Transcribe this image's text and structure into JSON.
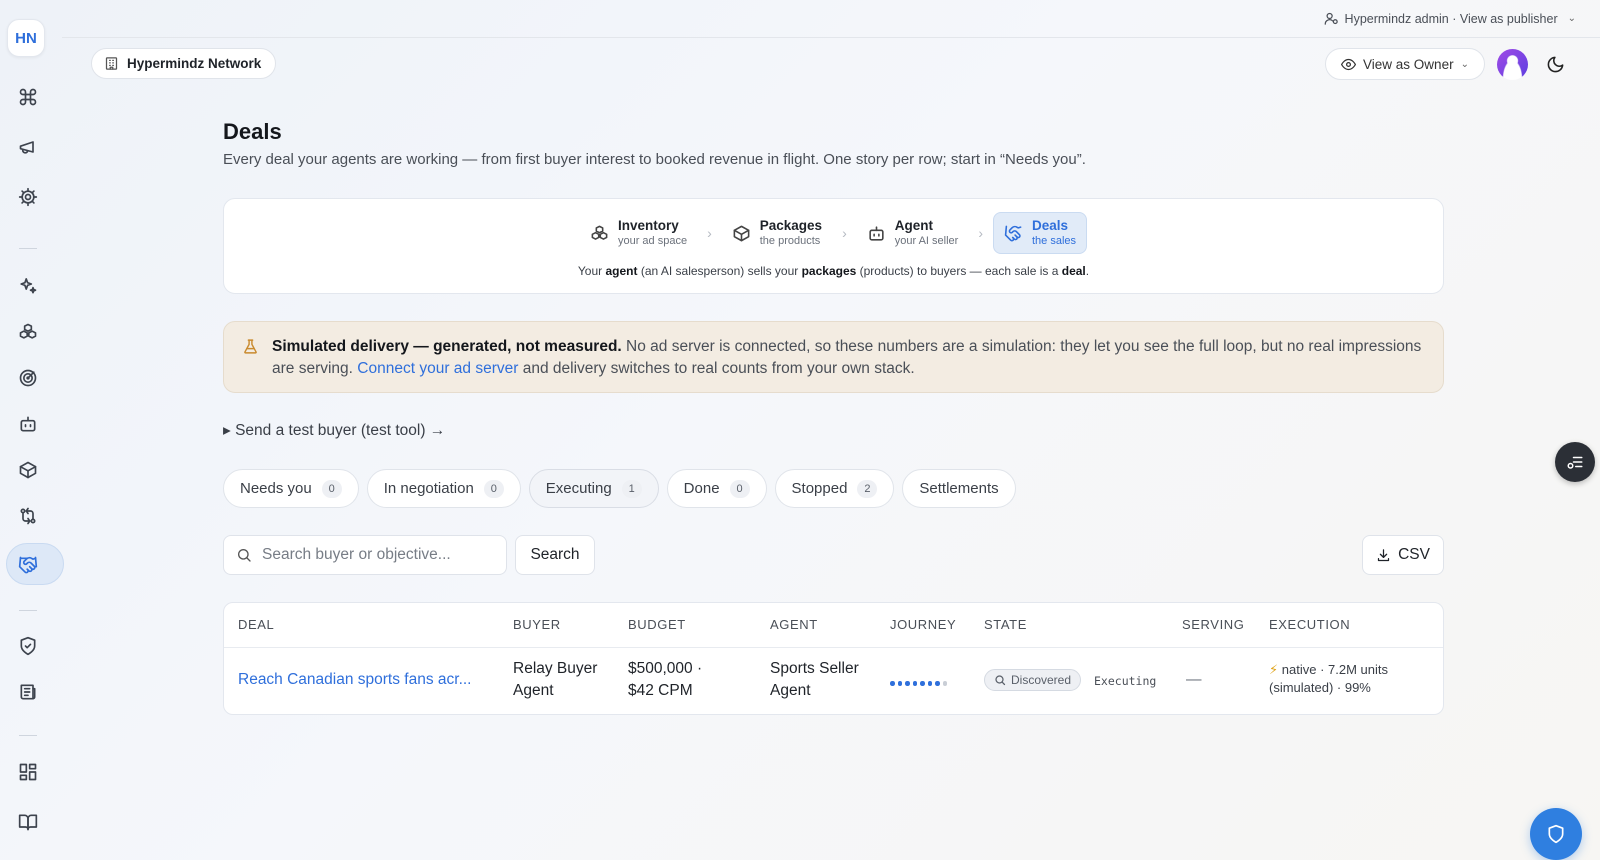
{
  "app": {
    "logo": "HN",
    "network_name": "Hypermindz Network",
    "admin_bar": "Hypermindz admin · View as publisher",
    "view_as": "View as Owner"
  },
  "sidebar": {
    "items": [
      {
        "icon": "command-icon"
      },
      {
        "icon": "megaphone-icon"
      },
      {
        "icon": "settings-gear-icon"
      },
      {
        "icon": "sparkles-icon"
      },
      {
        "icon": "inventory-boxes-icon"
      },
      {
        "icon": "target-icon"
      },
      {
        "icon": "bot-icon"
      },
      {
        "icon": "package-icon"
      },
      {
        "icon": "transfer-icon"
      },
      {
        "icon": "handshake-icon",
        "active": true
      },
      {
        "icon": "shield-check-icon"
      },
      {
        "icon": "ledger-icon"
      },
      {
        "icon": "grid-icon"
      },
      {
        "icon": "book-icon"
      }
    ]
  },
  "page": {
    "title": "Deals",
    "subtitle": "Every deal your agents are working — from first buyer interest to booked revenue in flight. One story per row; start in “Needs you”."
  },
  "flow": {
    "steps": [
      {
        "title": "Inventory",
        "sub": "your ad space",
        "icon": "inventory-icon"
      },
      {
        "title": "Packages",
        "sub": "the products",
        "icon": "package-icon"
      },
      {
        "title": "Agent",
        "sub": "your AI seller",
        "icon": "bot-icon"
      },
      {
        "title": "Deals",
        "sub": "the sales",
        "icon": "handshake-icon",
        "active": true
      }
    ],
    "note_parts": [
      "Your ",
      "agent",
      " (an AI salesperson) sells your ",
      "packages",
      " (products) to buyers — each sale is a ",
      "deal",
      "."
    ]
  },
  "banner": {
    "bold": "Simulated delivery — generated, not measured.",
    "text1": " No ad server is connected, so these numbers are a simulation: they let you see the full loop, but no real impressions are serving. ",
    "link": "Connect your ad server",
    "text2": " and delivery switches to real counts from your own stack."
  },
  "test_buyer": "▸ Send a test buyer (test tool) →",
  "tabs": [
    {
      "label": "Needs you",
      "count": "0"
    },
    {
      "label": "In negotiation",
      "count": "0"
    },
    {
      "label": "Executing",
      "count": "1",
      "active": true
    },
    {
      "label": "Done",
      "count": "0"
    },
    {
      "label": "Stopped",
      "count": "2"
    },
    {
      "label": "Settlements",
      "count": ""
    }
  ],
  "search": {
    "placeholder": "Search buyer or objective...",
    "button": "Search",
    "csv": "CSV"
  },
  "table": {
    "headers": [
      "DEAL",
      "BUYER",
      "BUDGET",
      "AGENT",
      "JOURNEY",
      "STATE",
      "SERVING",
      "EXECUTION"
    ],
    "rows": [
      {
        "deal": "Reach Canadian sports fans acr...",
        "buyer_l1": "Relay Buyer",
        "buyer_l2": "Agent",
        "budget_l1": "$500,000 ·",
        "budget_l2": "$42 CPM",
        "agent_l1": "Sports Seller",
        "agent_l2": "Agent",
        "journey_steps_total": 8,
        "journey_steps_done": 7,
        "state_badge": "Discovered",
        "state_text": "Executing",
        "serving": "—",
        "execution_l1": "native · 7.2M units",
        "execution_l2": "(simulated) · 99%"
      }
    ]
  }
}
